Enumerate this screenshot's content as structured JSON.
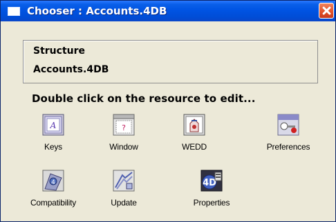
{
  "window": {
    "title": "Chooser : Accounts.4DB",
    "icon": "window-icon",
    "close_icon": "close-icon"
  },
  "info": {
    "line1": "Structure",
    "line2": "Accounts.4DB"
  },
  "instruction": "Double click on the resource to edit...",
  "resources": [
    {
      "label": "Keys",
      "icon": "keys-icon"
    },
    {
      "label": "Window",
      "icon": "window-form-icon"
    },
    {
      "label": "WEDD",
      "icon": "wedd-icon"
    },
    {
      "label": "Preferences",
      "icon": "preferences-icon"
    },
    {
      "label": "Compatibility",
      "icon": "compatibility-icon"
    },
    {
      "label": "Update",
      "icon": "update-icon"
    },
    {
      "label": "Properties",
      "icon": "properties-icon"
    }
  ],
  "colors": {
    "titlebar": "#0054e3",
    "dialog_bg": "#ece9d8",
    "close_button": "#e3542c"
  }
}
